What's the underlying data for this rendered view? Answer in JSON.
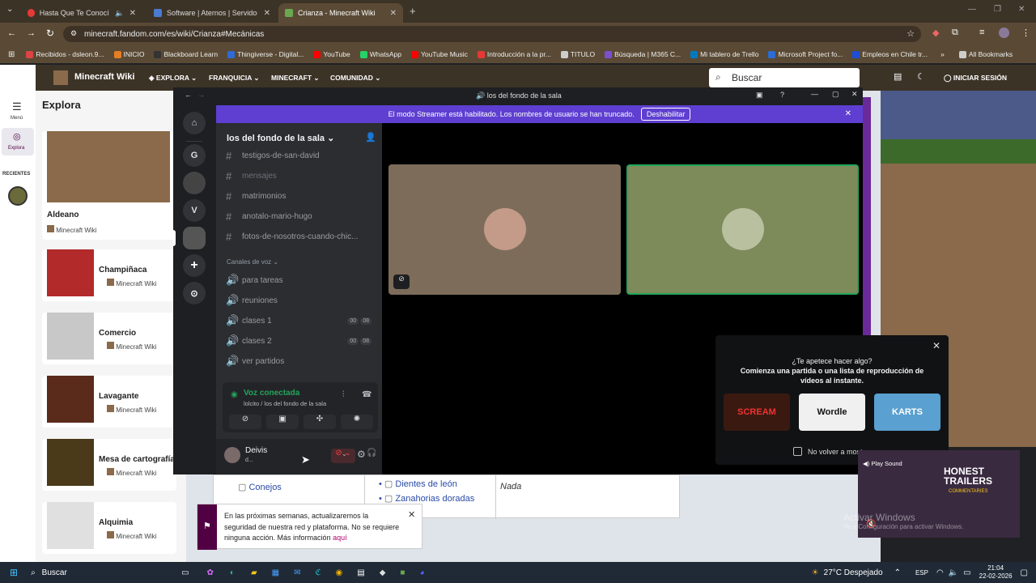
{
  "browser": {
    "tabs": [
      {
        "label": "Hasta Que Te Conocí (Popu",
        "color": "#e53935"
      },
      {
        "label": "Software | Aternos | Servidor de",
        "color": "#4a7bd0"
      },
      {
        "label": "Crianza - Minecraft Wiki",
        "color": "#6aa84f"
      }
    ],
    "url": "minecraft.fandom.com/es/wiki/Crianza#Mecánicas",
    "bookmarks": [
      {
        "label": "Recibidos - dsleon.9...",
        "color": "#d44"
      },
      {
        "label": "INICIO",
        "color": "#e67e22"
      },
      {
        "label": "Blackboard Learn",
        "color": "#333"
      },
      {
        "label": "Thingiverse - Digital...",
        "color": "#2e6bd6"
      },
      {
        "label": "YouTube",
        "color": "#f00"
      },
      {
        "label": "WhatsApp",
        "color": "#25d366"
      },
      {
        "label": "YouTube Music",
        "color": "#f00"
      },
      {
        "label": "Introducción a la pr...",
        "color": "#e53935"
      },
      {
        "label": "TITULO",
        "color": "#ccc"
      },
      {
        "label": "Búsqueda | M365 C...",
        "color": "#7b4fd0"
      },
      {
        "label": "Mi tablero de Trello",
        "color": "#0079bf"
      },
      {
        "label": "Microsoft Project fo...",
        "color": "#2b6cd6"
      },
      {
        "label": "Empleos en Chile tr...",
        "color": "#1d4ed8"
      }
    ],
    "all_bookmarks": "All Bookmarks"
  },
  "wiki": {
    "title": "Minecraft Wiki",
    "nav": [
      "EXPLORA",
      "FRANQUICIA",
      "MINECRAFT",
      "COMUNIDAD"
    ],
    "search_placeholder": "Buscar",
    "login": "INICIAR SESIÓN",
    "menu": "Menú",
    "explore": "Explora",
    "recent": "RECIENTES",
    "panel_title": "Explora",
    "cards": [
      {
        "name": "Aldeano",
        "src": "Minecraft Wiki"
      },
      {
        "name": "Champiñaca",
        "src": "Minecraft Wiki"
      },
      {
        "name": "Comercio",
        "src": "Minecraft Wiki"
      },
      {
        "name": "Lavagante",
        "src": "Minecraft Wiki"
      },
      {
        "name": "Mesa de cartografía",
        "src": "Minecraft Wiki"
      },
      {
        "name": "Alquimia",
        "src": "Minecraft Wiki"
      }
    ],
    "table": {
      "col1": "Conejos",
      "col2a": "Dientes de león",
      "col2b": "Zanahorias doradas",
      "col3": "Nada"
    },
    "notice": "En las próximas semanas, actualizaremos la seguridad de nuestra red y plataforma. No se requiere ninguna acción. Más información",
    "notice_link": "aquí"
  },
  "discord": {
    "window_title": "los del fondo de la sala",
    "streamer_text": "El modo Streamer está habilitado. Los nombres de usuario se han truncado.",
    "streamer_button": "Deshabilitar",
    "server_name": "los del fondo de la sala",
    "text_channels": [
      "testigos-de-san-david",
      "mensajes",
      "matrimonios",
      "anotalo-mario-hugo",
      "fotos-de-nosotros-cuando-chic..."
    ],
    "voice_header": "Canales de voz",
    "voice_channels": [
      {
        "name": "para tareas",
        "a": "",
        "b": ""
      },
      {
        "name": "reuniones",
        "a": "",
        "b": ""
      },
      {
        "name": "clases 1",
        "a": "00",
        "b": "08"
      },
      {
        "name": "clases 2",
        "a": "00",
        "b": "08"
      },
      {
        "name": "ver partidos",
        "a": "",
        "b": ""
      }
    ],
    "voice_status": "Voz conectada",
    "voice_sub": "lolcito / los del fondo de la sala",
    "user_name": "Deivis",
    "user_status": "d...",
    "guild_letters": [
      "G",
      "V"
    ],
    "activity": {
      "line1": "¿Te apetece hacer algo?",
      "line2": "Comienza una partida o una lista de reproducción de vídeos al instante.",
      "games": [
        "SCREAM",
        "Wordle",
        "KARTS"
      ],
      "checkbox": "No volver a mostrar"
    }
  },
  "video_overlay": {
    "play_sound": "Play Sound",
    "title": "HONEST TRAILERS",
    "subtitle": "COMMENTARIES"
  },
  "activate": {
    "line1": "Activar Windows",
    "line2": "Ve a Configuración para activar Windows."
  },
  "taskbar": {
    "search": "Buscar",
    "weather": "27°C  Despejado",
    "lang": "ESP",
    "time": "21:04",
    "date": "22-02-2026"
  }
}
